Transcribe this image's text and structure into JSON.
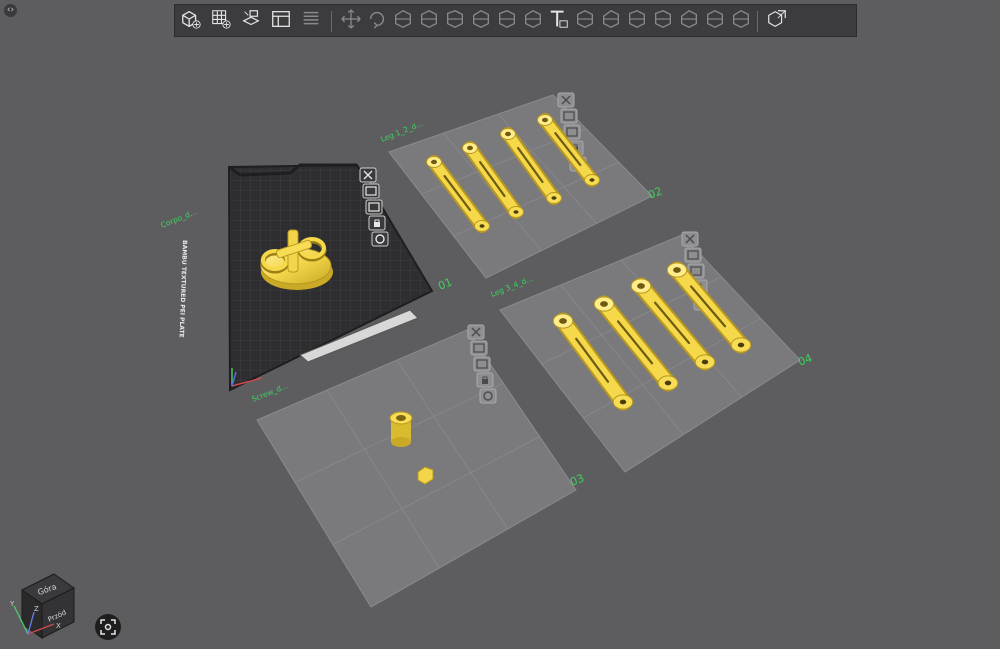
{
  "window": {
    "collapse_glyph": "‹›"
  },
  "toolbar": {
    "groups": [
      [
        "add-object-icon",
        "add-plate-icon",
        "arrange-icon",
        "plate-settings-icon",
        "list-icon"
      ],
      [
        "move-icon",
        "rotate-icon",
        "scale-icon",
        "lay-flat-icon",
        "cut-icon",
        "split-objects-icon",
        "split-parts-icon",
        "paint-support-icon",
        "text-icon",
        "add-part-icon",
        "hollow-icon",
        "boolean-icon",
        "measure-icon",
        "variable-layer-icon",
        "seam-icon",
        "mmu-paint-icon"
      ],
      [
        "assembly-icon"
      ]
    ],
    "text_tool_glyph": "T"
  },
  "plates": [
    {
      "number": "01",
      "name": "Corpo_d...",
      "active": true,
      "printer_label": "BAMBU TEXTURED PEI PLATE"
    },
    {
      "number": "02",
      "name": "Leg 1_2_d...",
      "active": false
    },
    {
      "number": "03",
      "name": "Screw_d...",
      "active": false
    },
    {
      "number": "04",
      "name": "Leg 3_4_d...",
      "active": false
    }
  ],
  "plate_actions": [
    "close-icon",
    "auto-arrange-icon",
    "orient-icon",
    "lock-icon",
    "plate-gear-icon"
  ],
  "view_cube": {
    "top": "Góra",
    "front": "Przód",
    "axis_x": "X",
    "axis_y": "Y",
    "axis_z": "Z"
  },
  "colors": {
    "object": "#f5d94a",
    "label": "#3cd35a",
    "background": "#5d5d60"
  }
}
